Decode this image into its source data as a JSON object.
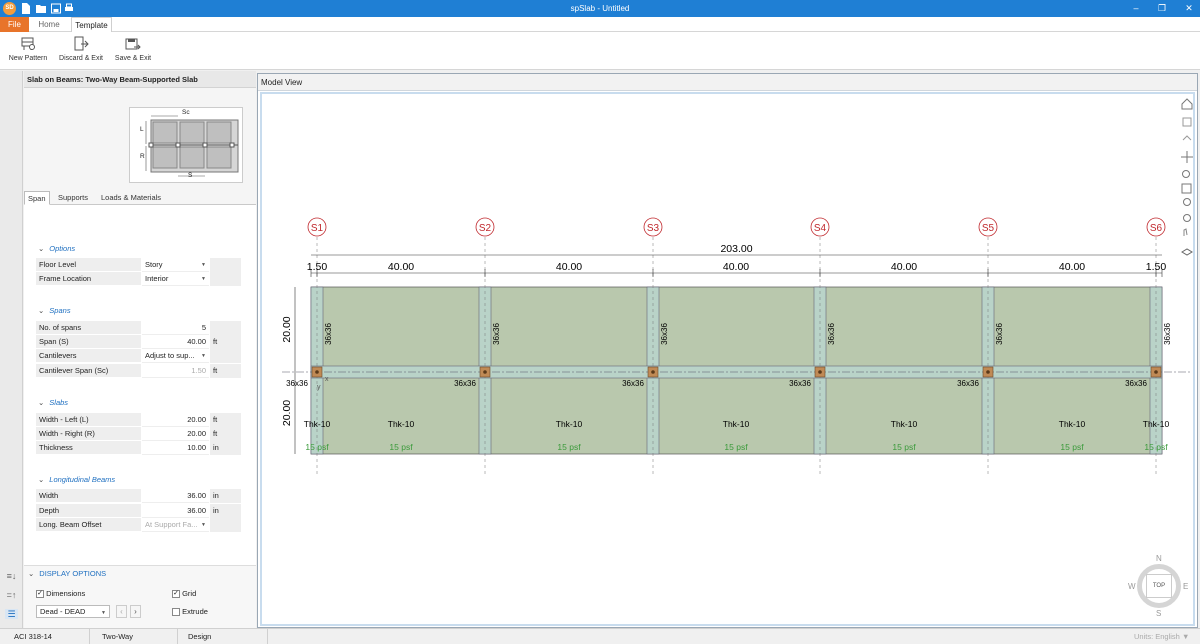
{
  "window": {
    "title": "spSlab - Untitled",
    "logo_text": "SD"
  },
  "ribbon_tabs": {
    "file": "File",
    "home": "Home",
    "template": "Template"
  },
  "ribbon": {
    "new_pattern": "New Pattern",
    "discard_exit": "Discard & Exit",
    "save_exit": "Save & Exit"
  },
  "panel": {
    "header": "Slab on Beams: Two-Way Beam-Supported Slab",
    "thumb": {
      "sc": "Sc",
      "l": "L",
      "r": "R",
      "s": "S"
    },
    "tabs": [
      "Span",
      "Supports",
      "Loads & Materials"
    ],
    "options": {
      "title": "Options",
      "floor_level": {
        "label": "Floor Level",
        "value": "Story"
      },
      "frame_location": {
        "label": "Frame Location",
        "value": "Interior"
      }
    },
    "spans": {
      "title": "Spans",
      "no_of_spans": {
        "label": "No. of spans",
        "value": "5"
      },
      "span_s": {
        "label": "Span (S)",
        "value": "40.00",
        "unit": "ft"
      },
      "cantilevers": {
        "label": "Cantilevers",
        "value": "Adjust to sup..."
      },
      "cantilever_span": {
        "label": "Cantilever Span (Sc)",
        "value": "1.50",
        "unit": "ft"
      }
    },
    "slabs": {
      "title": "Slabs",
      "width_left": {
        "label": "Width - Left (L)",
        "value": "20.00",
        "unit": "ft"
      },
      "width_right": {
        "label": "Width - Right (R)",
        "value": "20.00",
        "unit": "ft"
      },
      "thickness": {
        "label": "Thickness",
        "value": "10.00",
        "unit": "in"
      }
    },
    "beams": {
      "title": "Longitudinal Beams",
      "width": {
        "label": "Width",
        "value": "36.00",
        "unit": "in"
      },
      "depth": {
        "label": "Depth",
        "value": "36.00",
        "unit": "in"
      },
      "offset": {
        "label": "Long. Beam Offset",
        "value": "At Support Fa..."
      }
    },
    "display_options": {
      "title": "DISPLAY OPTIONS",
      "dimensions": "Dimensions",
      "grid": "Grid",
      "load_case": "Dead - DEAD",
      "extrude": "Extrude"
    }
  },
  "model": {
    "title": "Model View",
    "supports": [
      "S1",
      "S2",
      "S3",
      "S4",
      "S5",
      "S6"
    ],
    "total_length": "203.00",
    "spans": [
      "1.50",
      "40.00",
      "40.00",
      "40.00",
      "40.00",
      "40.00",
      "1.50"
    ],
    "width_left": "20.00",
    "width_right": "20.00",
    "column_size": "36x36",
    "thickness_label": "Thk-10",
    "load_label": "15 psf",
    "axis_y": "y",
    "axis_x": "x",
    "compass": {
      "n": "N",
      "s": "S",
      "e": "E",
      "w": "W",
      "center": "TOP"
    },
    "colors": {
      "slab": "#b9c8ad",
      "beam": "#b9d3c8",
      "column": "#c08a55",
      "support_label": "#c0282d"
    }
  },
  "status": {
    "code": "ACI 318-14",
    "system": "Two-Way",
    "mode": "Design",
    "units": "Units: English"
  }
}
